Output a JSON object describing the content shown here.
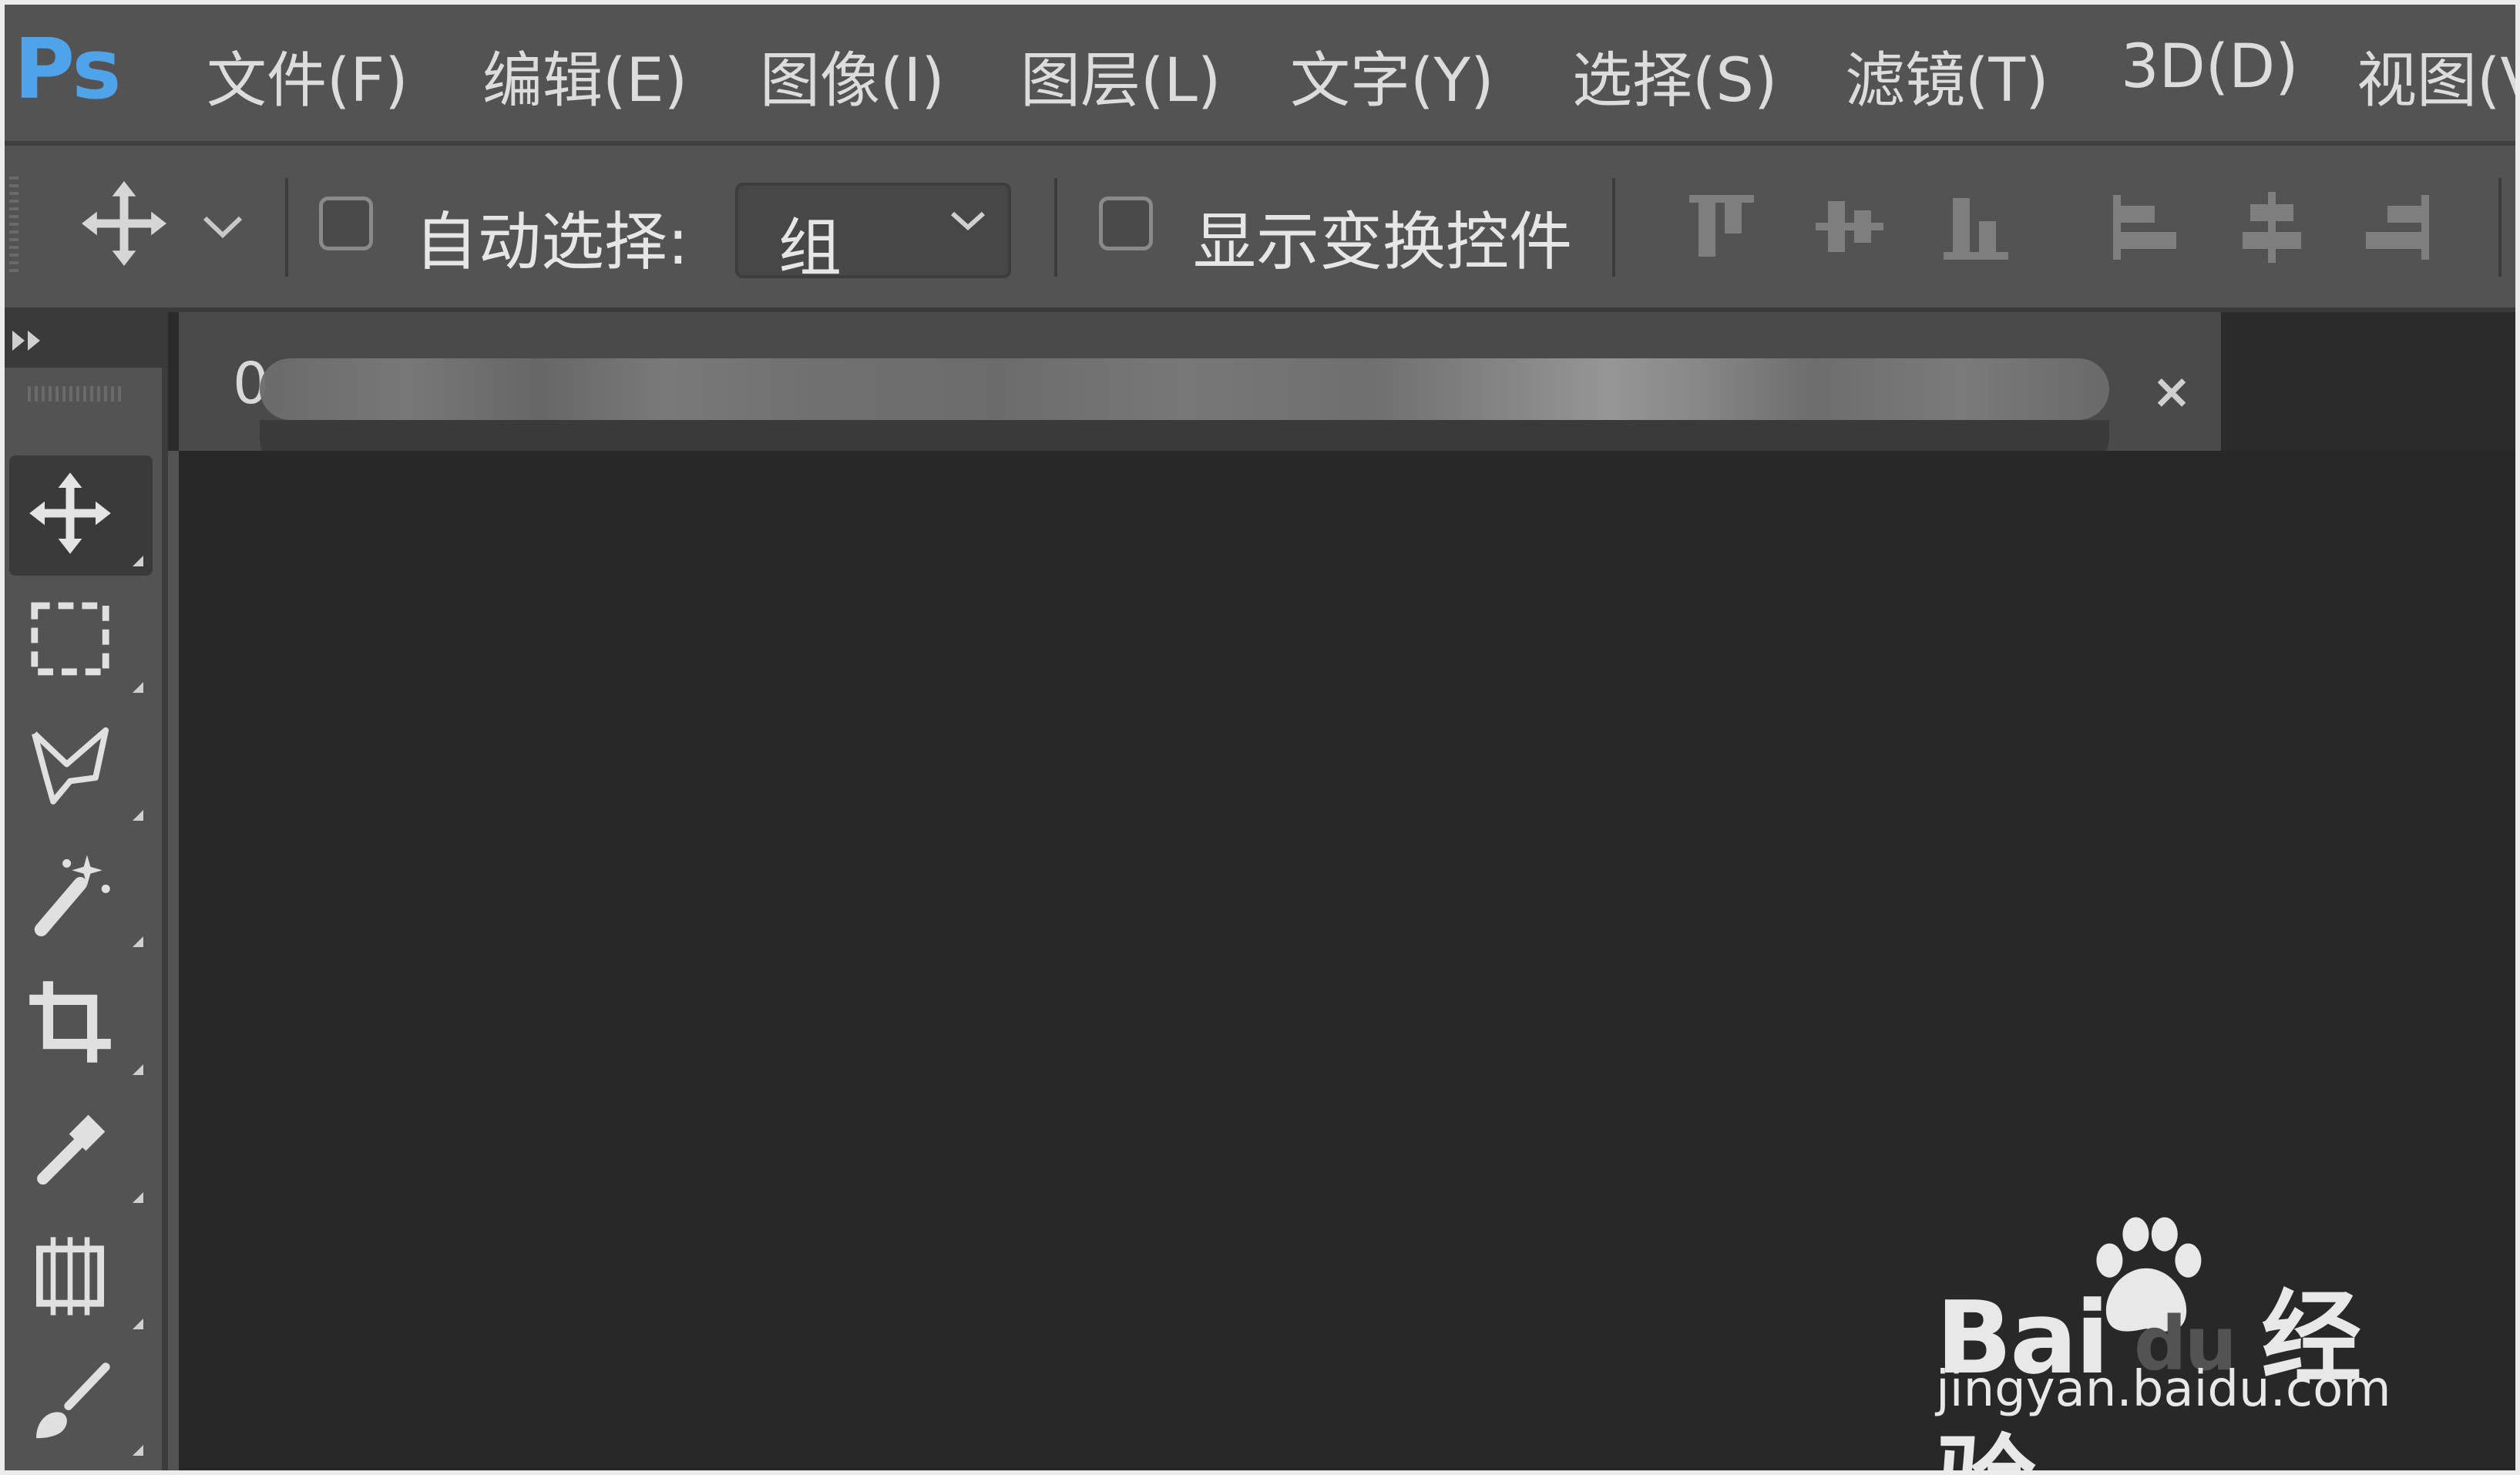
{
  "app": {
    "logo": "Ps",
    "colors": {
      "chrome": "#535353",
      "canvas": "#282828",
      "logo": "#4fa3e8",
      "text": "#dcdcdc"
    }
  },
  "menu": [
    {
      "label": "文件(F)"
    },
    {
      "label": "编辑(E)"
    },
    {
      "label": "图像(I)"
    },
    {
      "label": "图层(L)"
    },
    {
      "label": "文字(Y)"
    },
    {
      "label": "选择(S)"
    },
    {
      "label": "滤镜(T)"
    },
    {
      "label": "3D(D)"
    },
    {
      "label": "视图(V"
    }
  ],
  "options": {
    "tool_icon": "move-icon",
    "auto_select_label": "自动选择:",
    "auto_select_checked": false,
    "auto_select_target": "组",
    "show_transform_label": "显示变换控件",
    "show_transform_checked": false,
    "align_icons": [
      "align-top-edges-icon",
      "align-vertical-centers-icon",
      "align-bottom-edges-icon",
      "align-left-edges-icon",
      "align-horizontal-centers-icon",
      "align-right-edges-icon"
    ]
  },
  "document_tab": {
    "title_visible": "0",
    "close_glyph": "×"
  },
  "tools": [
    {
      "icon": "move-tool-icon",
      "active": true
    },
    {
      "icon": "rectangular-marquee-icon",
      "active": false
    },
    {
      "icon": "polygonal-lasso-icon",
      "active": false
    },
    {
      "icon": "magic-wand-icon",
      "active": false
    },
    {
      "icon": "crop-icon",
      "active": false
    },
    {
      "icon": "eyedropper-icon",
      "active": false
    },
    {
      "icon": "frame-tool-icon",
      "active": false
    },
    {
      "icon": "brush-icon",
      "active": false
    }
  ],
  "watermark": {
    "brand": "Bai",
    "brand_suffix": "du",
    "brand_cn": "经验",
    "url": "jingyan.baidu.com"
  }
}
